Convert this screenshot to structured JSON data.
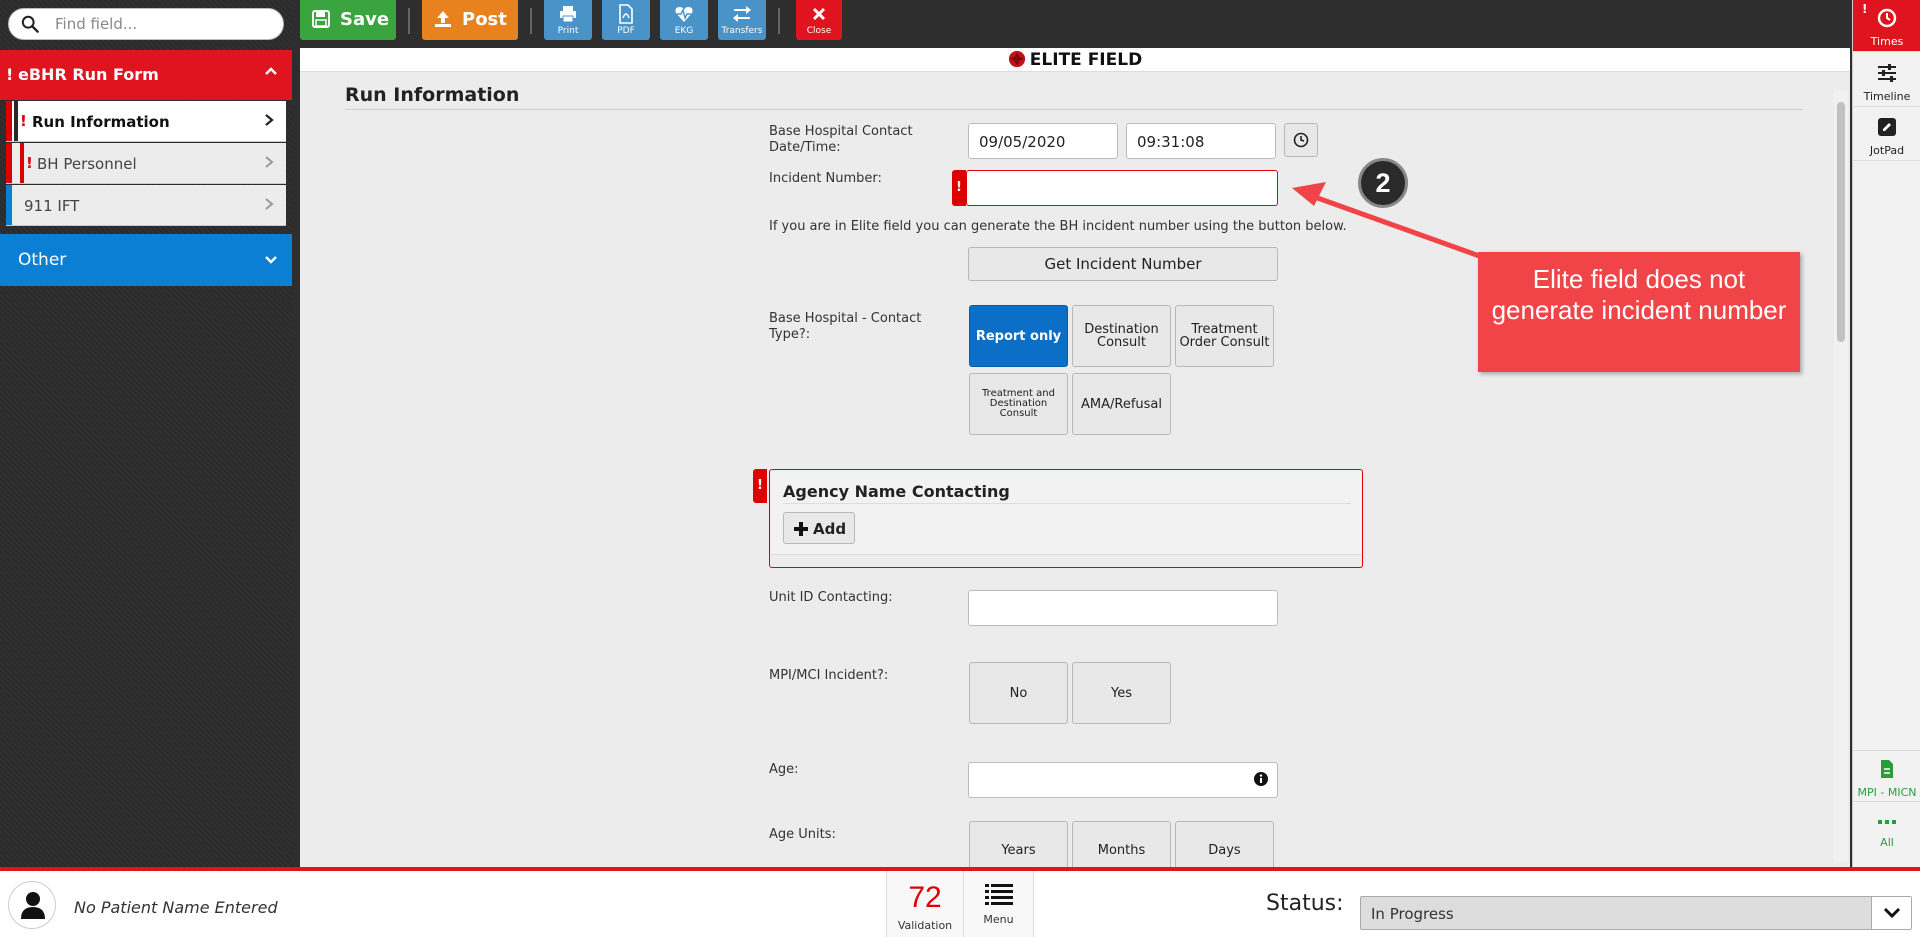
{
  "search": {
    "placeholder": "Find field..."
  },
  "sidebar": {
    "form_title": "eBHR Run Form",
    "form_flag": "!",
    "items": [
      {
        "label": "Run Information",
        "flag": "!"
      },
      {
        "label": "BH Personnel",
        "flag": "!"
      },
      {
        "label": "911 IFT",
        "flag": ""
      }
    ],
    "other_label": "Other"
  },
  "toolbar": {
    "save_label": "Save",
    "post_label": "Post",
    "print_label": "Print",
    "pdf_label": "PDF",
    "ekg_label": "EKG",
    "transfers_label": "Transfers",
    "close_label": "Close"
  },
  "app": {
    "title": "ELITE FIELD"
  },
  "section": {
    "title": "Run Information"
  },
  "form": {
    "contact_datetime_label": "Base Hospital Contact Date/Time:",
    "contact_date": "09/05/2020",
    "contact_time": "09:31:08",
    "incident_number_label": "Incident Number:",
    "incident_number_value": "",
    "incident_help": "If you are in Elite field you can generate the BH incident number using the button below.",
    "get_incident_label": "Get Incident Number",
    "contact_type_label": "Base Hospital - Contact Type?:",
    "contact_type_options": [
      "Report only",
      "Destination Consult",
      "Treatment Order Consult",
      "Treatment and Destination Consult",
      "AMA/Refusal"
    ],
    "agency_label": "Agency Name Contacting",
    "add_label": "Add",
    "unit_id_label": "Unit ID Contacting:",
    "unit_id_value": "",
    "mci_label": "MPI/MCI Incident?:",
    "mci_options": [
      "No",
      "Yes"
    ],
    "age_label": "Age:",
    "age_value": "",
    "age_units_label": "Age Units:",
    "age_units_options": [
      "Years",
      "Months",
      "Days"
    ]
  },
  "annotation": {
    "step_number": "2",
    "callout_text": "Elite field does not generate incident number"
  },
  "right_panel": {
    "times_label": "Times",
    "timeline_label": "Timeline",
    "jotpad_label": "JotPad",
    "mpi_label": "MPI - MICN",
    "all_label": "All"
  },
  "bottom": {
    "patient_name": "No Patient Name Entered",
    "validation_count": "72",
    "validation_label": "Validation",
    "menu_label": "Menu",
    "status_label": "Status:",
    "status_value": "In Progress"
  },
  "colors": {
    "accent_red": "#e0141e",
    "accent_blue": "#0b7fd3",
    "save_green": "#3aa53f",
    "post_orange": "#e8821e",
    "tool_blue": "#4a93c8",
    "callout_red": "#f04448"
  }
}
